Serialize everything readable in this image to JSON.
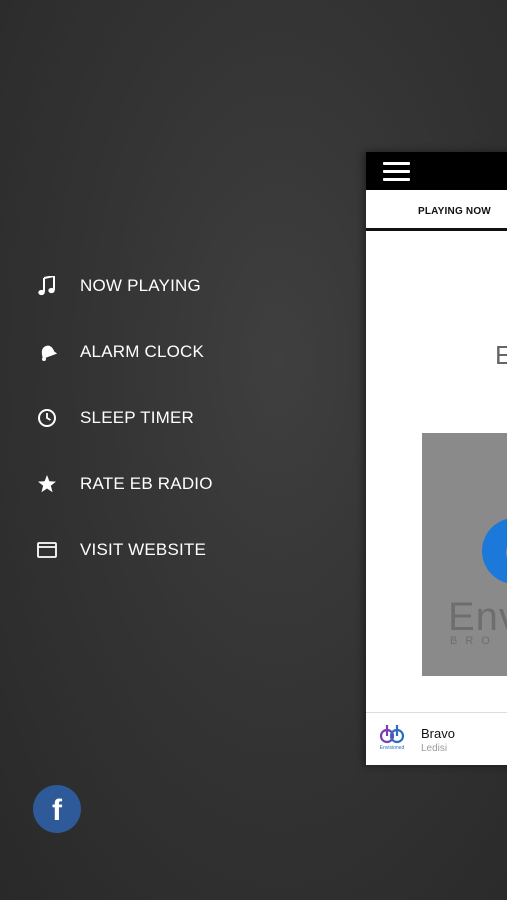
{
  "menu": {
    "items": [
      {
        "label": "NOW PLAYING",
        "icon": "music-note-icon"
      },
      {
        "label": "ALARM CLOCK",
        "icon": "alarm-bell-icon"
      },
      {
        "label": "SLEEP TIMER",
        "icon": "clock-icon"
      },
      {
        "label": "RATE EB RADIO",
        "icon": "star-icon"
      },
      {
        "label": "VISIT WEBSITE",
        "icon": "browser-window-icon"
      }
    ]
  },
  "social": {
    "facebook_glyph": "f",
    "facebook_color": "#2f5a9a"
  },
  "main_panel": {
    "tab_label": "PLAYING NOW",
    "logo_text": "E",
    "artwork": {
      "text": "Env",
      "subtext": "BRO",
      "accent_color": "#1c79d9"
    },
    "mini_player": {
      "logo_text": "Envisioned",
      "title": "Bravo",
      "artist": "Ledisi"
    }
  }
}
